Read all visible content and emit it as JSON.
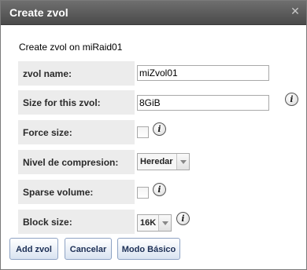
{
  "window": {
    "title": "Create zvol"
  },
  "subtitle": "Create zvol on miRaid01",
  "fields": {
    "zvol_name": {
      "label": "zvol name:",
      "value": "miZvol01"
    },
    "size": {
      "label": "Size for this zvol:",
      "value": "8GiB"
    },
    "force_size": {
      "label": "Force size:",
      "checked": false
    },
    "compression": {
      "label": "Nivel de compresion:",
      "value": "Heredar"
    },
    "sparse": {
      "label": "Sparse volume:",
      "checked": false
    },
    "block_size": {
      "label": "Block size:",
      "value": "16K"
    }
  },
  "buttons": {
    "add": "Add zvol",
    "cancel": "Cancelar",
    "basic_mode": "Modo Básico"
  },
  "icons": {
    "close": "close-icon",
    "info": "info-icon"
  },
  "info_glyph": "i",
  "close_glyph": "✕"
}
